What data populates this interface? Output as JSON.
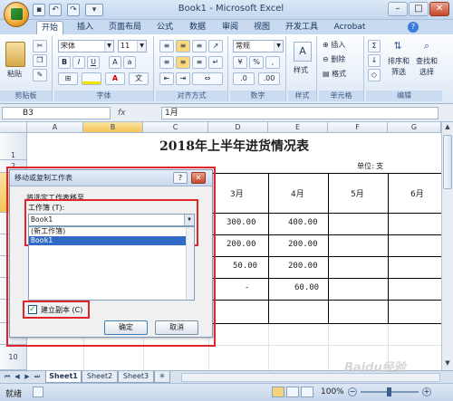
{
  "app_title": "Book1 - Microsoft Excel",
  "qat": {
    "save_icon": "save-icon",
    "undo_icon": "undo-icon",
    "redo_icon": "redo-icon"
  },
  "tabs": [
    "开始",
    "插入",
    "页面布局",
    "公式",
    "数据",
    "审阅",
    "视图",
    "开发工具",
    "Acrobat"
  ],
  "ribbon": {
    "paste_label": "粘贴",
    "clipboard_label": "剪贴板",
    "font_name": "宋体",
    "font_size": "11",
    "bold": "B",
    "italic": "I",
    "underline": "U",
    "font_label": "字体",
    "align_label": "对齐方式",
    "number_format": "常规",
    "percent": "%",
    "comma": ",",
    "number_label": "数字",
    "style_label": "样式",
    "insert_label": "插入",
    "delete_label": "删除",
    "format_label": "格式",
    "cells_label": "单元格",
    "sort_label": "排序和\n筛选",
    "find_label": "查找和\n选择",
    "edit_label": "编辑"
  },
  "formula_bar": {
    "name_box": "B3",
    "fx": "fx",
    "value": "1月"
  },
  "grid": {
    "columns": [
      "A",
      "B",
      "C",
      "D",
      "E",
      "F",
      "G"
    ],
    "rows": [
      "1",
      "2",
      "3",
      "4",
      "5",
      "6",
      "7",
      "8",
      "9",
      "10"
    ],
    "title": "2018年上半年进货情况表",
    "unit_label": "单位: 支",
    "months": [
      "3月",
      "4月",
      "5月",
      "6月"
    ],
    "row4": [
      "300.00",
      "400.00"
    ],
    "row5": [
      "200.00",
      "200.00"
    ],
    "row6": [
      "50.00",
      "200.00"
    ],
    "row7": [
      "-",
      "60.00"
    ]
  },
  "dialog": {
    "title": "移动或复制工作表",
    "help": "?",
    "close": "✕",
    "move_label": "将选定工作表移至",
    "workbook_label": "工作簿 (T):",
    "workbook_value": "Book1",
    "list_items": [
      "(新工作簿)",
      "Book1"
    ],
    "copy_label": "建立副本 (C)",
    "ok": "确定",
    "cancel": "取消"
  },
  "sheets": [
    "Sheet1",
    "Sheet2",
    "Sheet3"
  ],
  "status": {
    "ready": "就绪",
    "zoom": "100%"
  },
  "watermark": "Baidu经验"
}
